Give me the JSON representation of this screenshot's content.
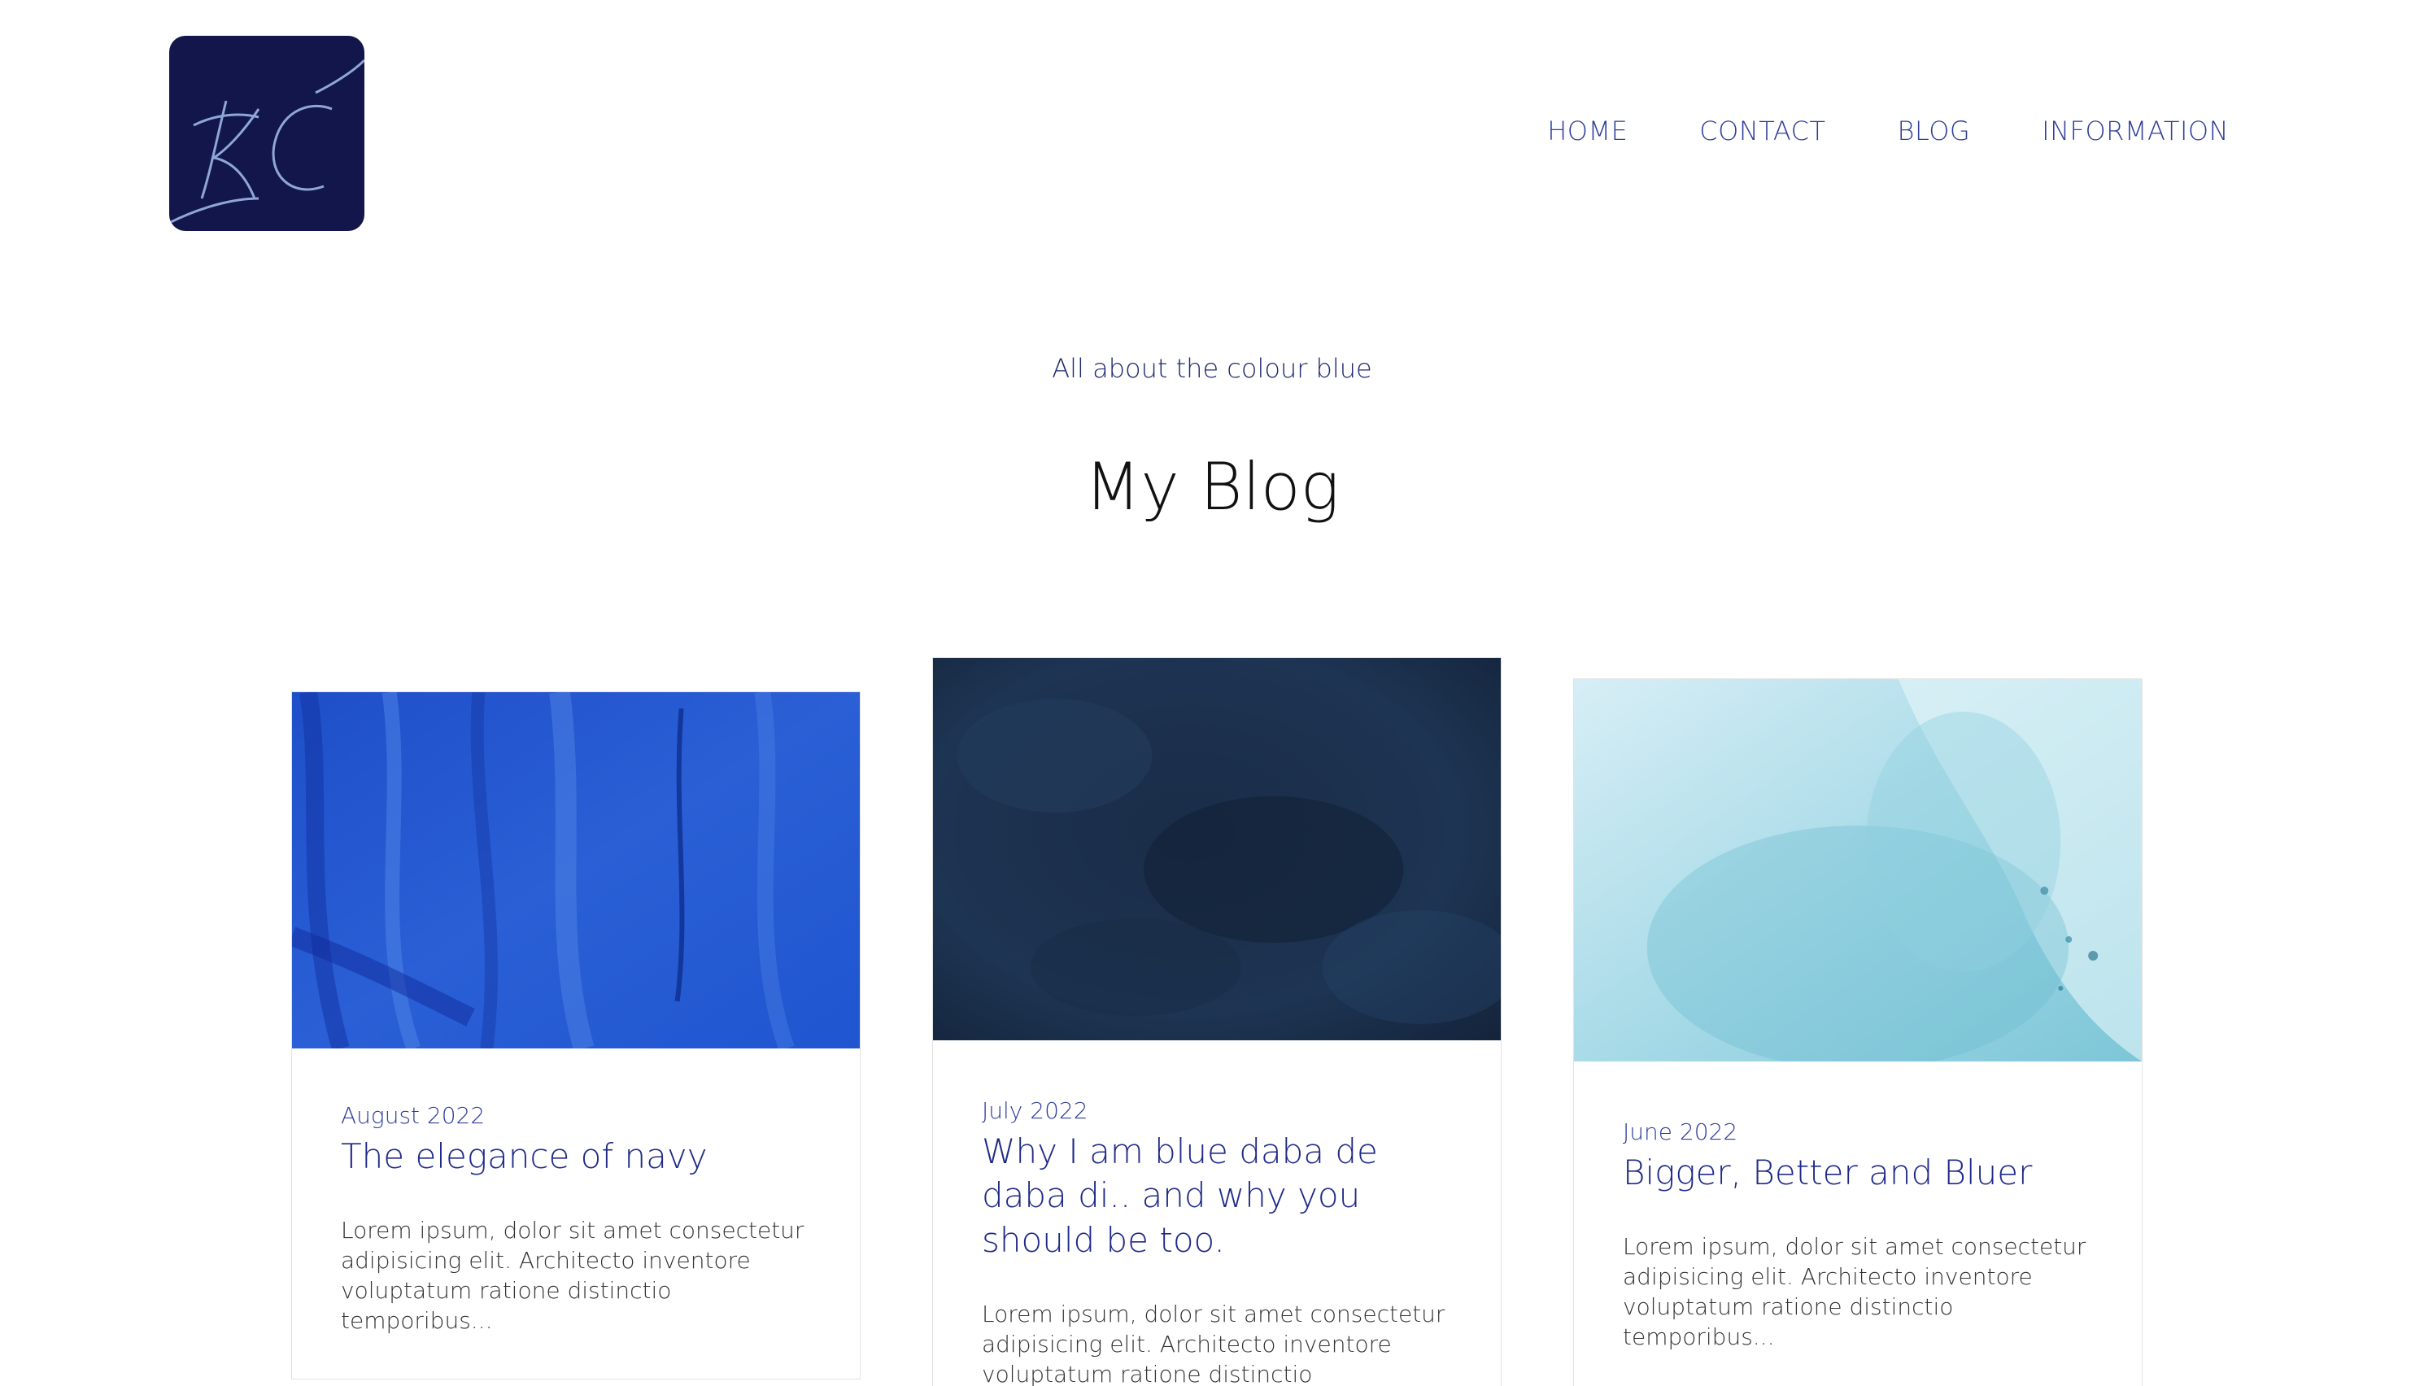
{
  "header": {
    "logo_text": "KC",
    "nav": [
      {
        "label": "HOME"
      },
      {
        "label": "CONTACT"
      },
      {
        "label": "BLOG"
      },
      {
        "label": "INFORMATION"
      }
    ]
  },
  "hero": {
    "tagline": "All about the colour blue",
    "title": "My Blog"
  },
  "posts": [
    {
      "date": "August 2022",
      "title": "The elegance of navy",
      "excerpt": "Lorem ipsum, dolor sit amet consectetur adipisicing elit. Architecto inventore voluptatum ratione distinctio temporibus..."
    },
    {
      "date": "July 2022",
      "title": "Why I am blue daba de daba di.. and why you should be too.",
      "excerpt": "Lorem ipsum, dolor sit amet consectetur adipisicing elit. Architecto inventore voluptatum ratione distinctio temporibus..."
    },
    {
      "date": "June 2022",
      "title": "Bigger, Better and Bluer",
      "excerpt": "Lorem ipsum, dolor sit amet consectetur adipisicing elit. Architecto inventore voluptatum ratione distinctio temporibus..."
    }
  ],
  "colors": {
    "logo_bg": "#13164a",
    "nav_text": "#2f3f9a",
    "title_text": "#1f2a88"
  }
}
